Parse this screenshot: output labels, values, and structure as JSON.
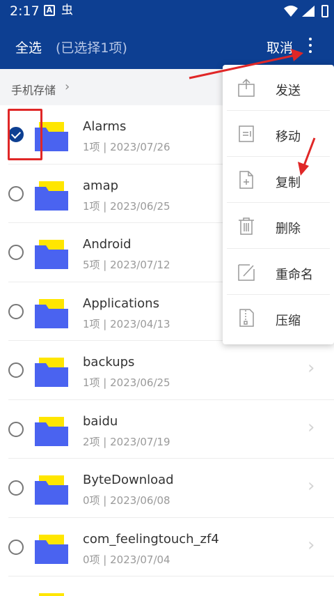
{
  "status_bar": {
    "time": "2:17",
    "icon_a": "A",
    "icon_b": "虫"
  },
  "app_bar": {
    "select_all": "全选",
    "selected_count": "(已选择1项)",
    "cancel": "取消"
  },
  "breadcrumb": {
    "label": "手机存储",
    "chevron": "›"
  },
  "files": [
    {
      "name": "Alarms",
      "meta": "1项 | 2023/07/26",
      "checked": true
    },
    {
      "name": "amap",
      "meta": "1项 | 2023/06/25",
      "checked": false
    },
    {
      "name": "Android",
      "meta": "5项 | 2023/07/12",
      "checked": false
    },
    {
      "name": "Applications",
      "meta": "1项 | 2023/04/13",
      "checked": false
    },
    {
      "name": "backups",
      "meta": "1项 | 2023/06/25",
      "checked": false
    },
    {
      "name": "baidu",
      "meta": "2项 | 2023/07/19",
      "checked": false
    },
    {
      "name": "ByteDownload",
      "meta": "0项 | 2023/06/08",
      "checked": false
    },
    {
      "name": "com_feelingtouch_zf4",
      "meta": "0项 | 2023/07/04",
      "checked": false
    }
  ],
  "menu": {
    "items": [
      {
        "label": "发送",
        "icon": "share-icon"
      },
      {
        "label": "移动",
        "icon": "move-icon"
      },
      {
        "label": "复制",
        "icon": "copy-icon"
      },
      {
        "label": "删除",
        "icon": "trash-icon"
      },
      {
        "label": "重命名",
        "icon": "rename-icon"
      },
      {
        "label": "压缩",
        "icon": "compress-icon"
      }
    ]
  },
  "colors": {
    "primary": "#0d3f92",
    "folder_yellow": "#ffe600",
    "folder_blue": "#4a63f0",
    "annotation_red": "#e02727"
  }
}
